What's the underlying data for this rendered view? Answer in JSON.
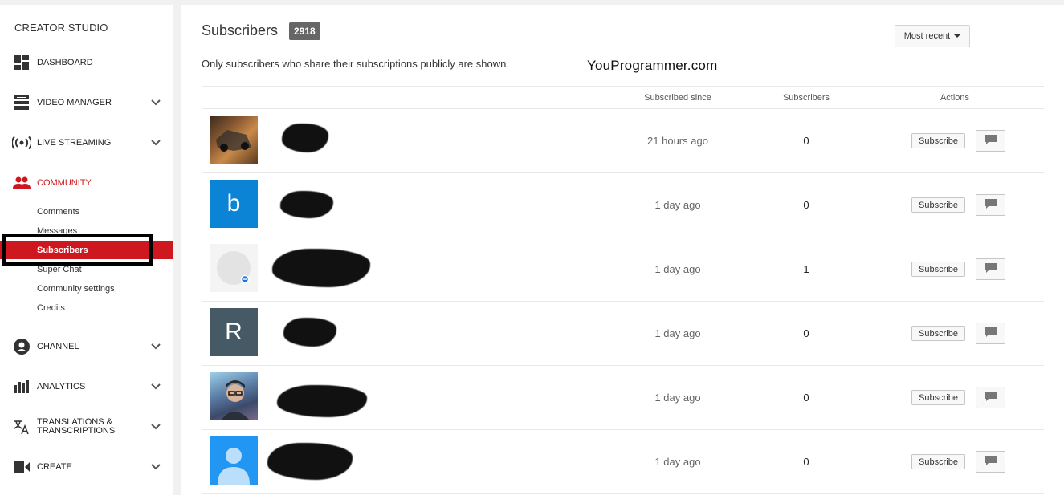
{
  "sidebar": {
    "title": "CREATOR STUDIO",
    "nav": [
      {
        "label": "DASHBOARD",
        "icon": "dashboard-icon"
      },
      {
        "label": "VIDEO MANAGER",
        "icon": "video-manager-icon"
      },
      {
        "label": "LIVE STREAMING",
        "icon": "live-streaming-icon"
      },
      {
        "label": "COMMUNITY",
        "icon": "community-icon"
      },
      {
        "label": "CHANNEL",
        "icon": "channel-icon"
      },
      {
        "label": "ANALYTICS",
        "icon": "analytics-icon"
      },
      {
        "label": "TRANSLATIONS &\nTRANSCRIPTIONS",
        "icon": "translate-icon"
      },
      {
        "label": "CREATE",
        "icon": "create-icon"
      }
    ],
    "community_items": [
      {
        "label": "Comments"
      },
      {
        "label": "Messages"
      },
      {
        "label": "Subscribers"
      },
      {
        "label": "Super Chat"
      },
      {
        "label": "Community settings"
      },
      {
        "label": "Credits"
      }
    ],
    "accent_color": "#cc181e"
  },
  "header": {
    "title": "Subscribers",
    "count": "2918",
    "notice": "Only subscribers who share their subscriptions publicly are shown.",
    "watermark": "YouProgrammer.com",
    "sort_label": "Most recent"
  },
  "table": {
    "columns": [
      "Subscribed since",
      "Subscribers",
      "Actions"
    ],
    "subscribe_label": "Subscribe",
    "rows": [
      {
        "avatar": "photo-car",
        "since": "21 hours ago",
        "subscribers": "0"
      },
      {
        "avatar": "letter",
        "letter": "b",
        "color": "#0b84d6",
        "since": "1 day ago",
        "subscribers": "0"
      },
      {
        "avatar": "default-gray",
        "since": "1 day ago",
        "subscribers": "1"
      },
      {
        "avatar": "letter",
        "letter": "R",
        "color": "#455a64",
        "since": "1 day ago",
        "subscribers": "0"
      },
      {
        "avatar": "photo-person",
        "since": "1 day ago",
        "subscribers": "0"
      },
      {
        "avatar": "default-blue",
        "since": "1 day ago",
        "subscribers": "0"
      }
    ]
  }
}
